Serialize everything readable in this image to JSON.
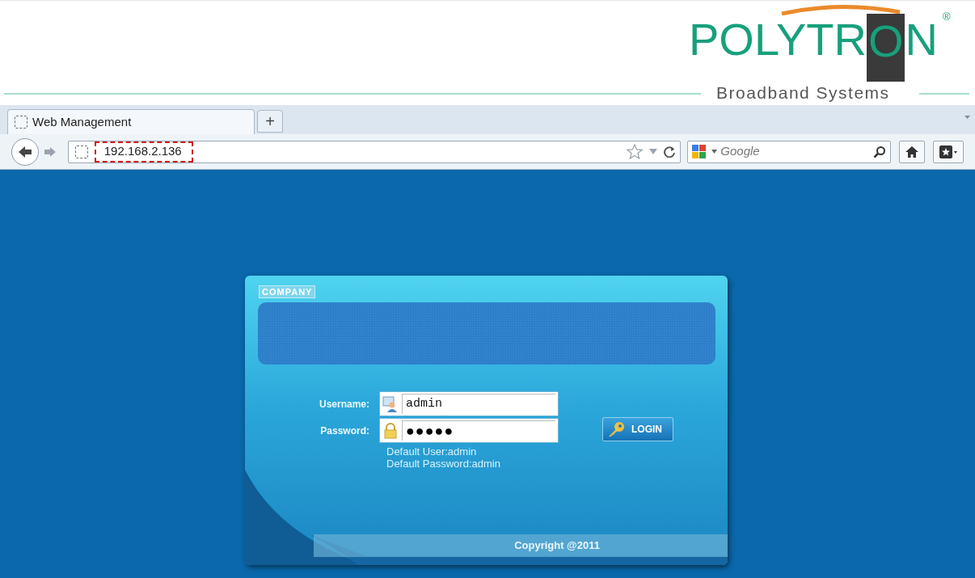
{
  "logo": {
    "name": "POLYTRON",
    "registered": "®",
    "tagline": "Broadband Systems"
  },
  "browser": {
    "tabs": [
      {
        "label": "Web Management",
        "selected": true
      }
    ],
    "new_tab": "+",
    "address": "192.168.2.136",
    "search": {
      "placeholder": "Google"
    }
  },
  "login": {
    "badge": "COMPANY",
    "fields": [
      {
        "label": "Username:",
        "kind": "user",
        "value": "admin"
      },
      {
        "label": "Password:",
        "kind": "password",
        "value": "●●●●●"
      }
    ],
    "hints": [
      "Default User:admin",
      "Default Password:admin"
    ],
    "button": "LOGIN",
    "copyright": "Copyright @2011"
  }
}
